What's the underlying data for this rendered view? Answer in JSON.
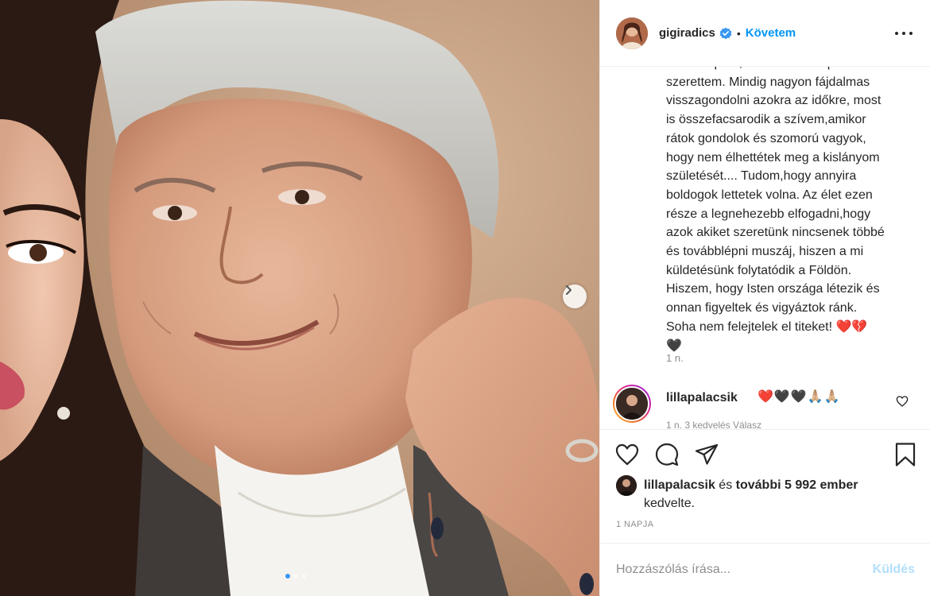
{
  "post": {
    "username": "gigiradics",
    "verified": true,
    "separator": "•",
    "follow_label": "Követem",
    "more_icon": "more-options-icon"
  },
  "caption": {
    "text": "keresztapám, akit második apámként\nszerettem. Mindig nagyon fájdalmas\nvisszagondolni azokra az időkre, most\nis összefacsarodik a szívem,amikor\nrátok gondolok és szomorú vagyok,\nhogy nem élhettétek meg a kislányom\nszületését.... Tudom,hogy annyira\nboldogok lettetek volna. Az élet ezen\nrésze a legnehezebb elfogadni,hogy\nazok akiket szeretünk nincsenek többé\nés továbblépni muszáj, hiszen a mi\nküldetésünk folytatódik a Földön.\nHiszem, hogy Isten országa létezik és\nonnan figyeltek és vigyáztok ránk.\nSoha nem felejtelek el titeket! ❤️💔\n🖤",
    "time": "1 n."
  },
  "comment": {
    "username": "lillapalacsik",
    "text": "❤️🖤🖤🙏🏼🙏🏼",
    "meta": "1 n.   3 kedvelés   Válasz"
  },
  "likes": {
    "username": "lillapalacsik",
    "middle": " és ",
    "others": "további 5 992 ember",
    "suffix": "kedvelte."
  },
  "date": "1 NAPJA",
  "add_comment": {
    "placeholder": "Hozzászólás írása...",
    "send_label": "Küldés"
  },
  "carousel": {
    "slides": 3,
    "active": 1
  },
  "colors": {
    "accent": "#0095f6",
    "verified": "#3897f0",
    "heart_red": "#ed4956",
    "send_disabled": "#b2dffc"
  }
}
